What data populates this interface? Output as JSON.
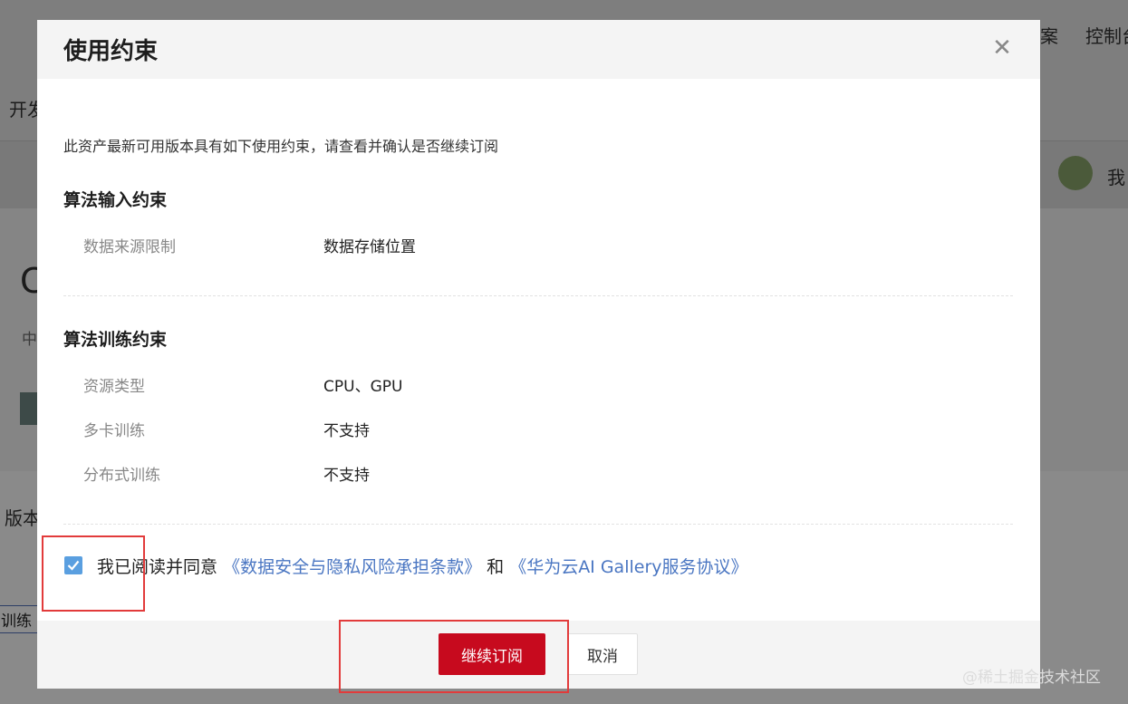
{
  "background": {
    "nav_right_1": "案",
    "nav_right_2": "控制台",
    "nav_left": "开发",
    "user_label": "我",
    "heading_char": "C",
    "sub_char": "中",
    "version_label": "版本",
    "tag_label": "训练"
  },
  "modal": {
    "title": "使用约束",
    "intro": "此资产最新可用版本具有如下使用约束，请查看并确认是否继续订阅",
    "sections": [
      {
        "title": "算法输入约束",
        "rows": [
          {
            "label": "数据来源限制",
            "value": "数据存储位置"
          }
        ]
      },
      {
        "title": "算法训练约束",
        "rows": [
          {
            "label": "资源类型",
            "value": "CPU、GPU"
          },
          {
            "label": "多卡训练",
            "value": "不支持"
          },
          {
            "label": "分布式训练",
            "value": "不支持"
          }
        ]
      }
    ],
    "agreement": {
      "checked": true,
      "prefix": "我已阅读并同意",
      "link1": "《数据安全与隐私风险承担条款》",
      "connector": "和",
      "link2": "《华为云AI Gallery服务协议》"
    },
    "buttons": {
      "confirm": "继续订阅",
      "cancel": "取消"
    }
  },
  "colors": {
    "primary": "#c70a1e",
    "link": "#4a76c2",
    "checkbox": "#5a9fe0",
    "highlight": "#e23b3b"
  },
  "watermark": "@稀土掘金技术社区"
}
